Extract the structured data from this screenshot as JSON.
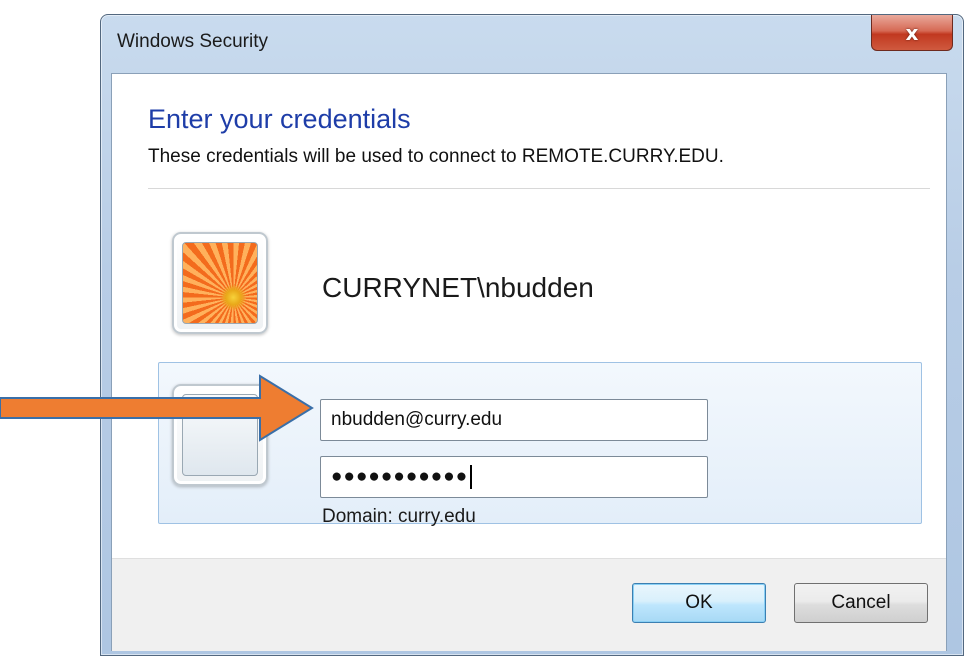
{
  "window": {
    "title": "Windows Security",
    "close_glyph": "x"
  },
  "dialog": {
    "heading": "Enter your credentials",
    "subtext": "These credentials will be used to connect to REMOTE.CURRY.EDU."
  },
  "account": {
    "display_name": "CURRYNET\\nbudden",
    "icon": "user-picture-flower-icon"
  },
  "credentials": {
    "icon": "blank-user-picture-icon",
    "username_value": "nbudden@curry.edu",
    "password_masked": "●●●●●●●●●●●",
    "domain_label": "Domain: curry.edu"
  },
  "buttons": {
    "ok_label": "OK",
    "cancel_label": "Cancel"
  },
  "annotation": {
    "icon": "orange-arrow-icon",
    "color": "#ee7d31"
  },
  "colors": {
    "heading": "#1e3da8",
    "close_button": "#c1381f",
    "selection_panel": "#e3eef9"
  }
}
